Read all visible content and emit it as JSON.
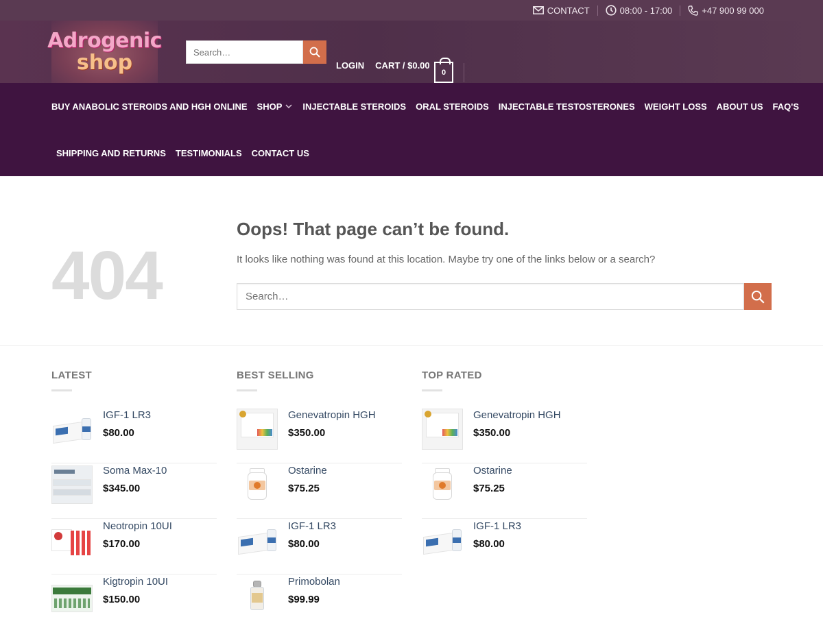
{
  "topbar": {
    "contact_label": "CONTACT",
    "hours": "08:00 - 17:00",
    "phone": "+47 900 99 000"
  },
  "header": {
    "logo_line1": "Adrogenic",
    "logo_line2": "shop",
    "search_placeholder": "Search…",
    "login_label": "LOGIN",
    "cart_label": "CART / $0.00",
    "cart_count": "0"
  },
  "nav": {
    "row1": [
      "BUY ANABOLIC STEROIDS AND HGH ONLINE",
      "SHOP",
      "INJECTABLE STEROIDS",
      "ORAL STEROIDS",
      "INJECTABLE TESTOSTERONES",
      "WEIGHT LOSS",
      "ABOUT US",
      "FAQ'S"
    ],
    "row2": [
      "SHIPPING AND RETURNS",
      "TESTIMONIALS",
      "CONTACT US"
    ]
  },
  "error": {
    "code": "404",
    "title": "Oops! That page can’t be found.",
    "message": "It looks like nothing was found at this location. Maybe try one of the links below or a search?",
    "search_placeholder": "Search…"
  },
  "columns": [
    {
      "title": "LATEST",
      "items": [
        {
          "name": "IGF-1 LR3",
          "price": "$80.00",
          "thumb": "igf"
        },
        {
          "name": "Soma Max-10",
          "price": "$345.00",
          "thumb": "soma"
        },
        {
          "name": "Neotropin 10UI",
          "price": "$170.00",
          "thumb": "neo"
        },
        {
          "name": "Kigtropin 10UI",
          "price": "$150.00",
          "thumb": "kig"
        }
      ]
    },
    {
      "title": "BEST SELLING",
      "items": [
        {
          "name": "Genevatropin HGH",
          "price": "$350.00",
          "thumb": "gene"
        },
        {
          "name": "Ostarine",
          "price": "$75.25",
          "thumb": "osta"
        },
        {
          "name": "IGF-1 LR3",
          "price": "$80.00",
          "thumb": "igf"
        },
        {
          "name": "Primobolan",
          "price": "$99.99",
          "thumb": "primo"
        }
      ]
    },
    {
      "title": "TOP RATED",
      "items": [
        {
          "name": "Genevatropin HGH",
          "price": "$350.00",
          "thumb": "gene"
        },
        {
          "name": "Ostarine",
          "price": "$75.25",
          "thumb": "osta"
        },
        {
          "name": "IGF-1 LR3",
          "price": "$80.00",
          "thumb": "igf"
        }
      ]
    }
  ],
  "colors": {
    "topbar": "#5a3a52",
    "header": "#4f2f4a",
    "nav": "#3f1440",
    "accent": "#d26e4b",
    "link": "#334862"
  }
}
